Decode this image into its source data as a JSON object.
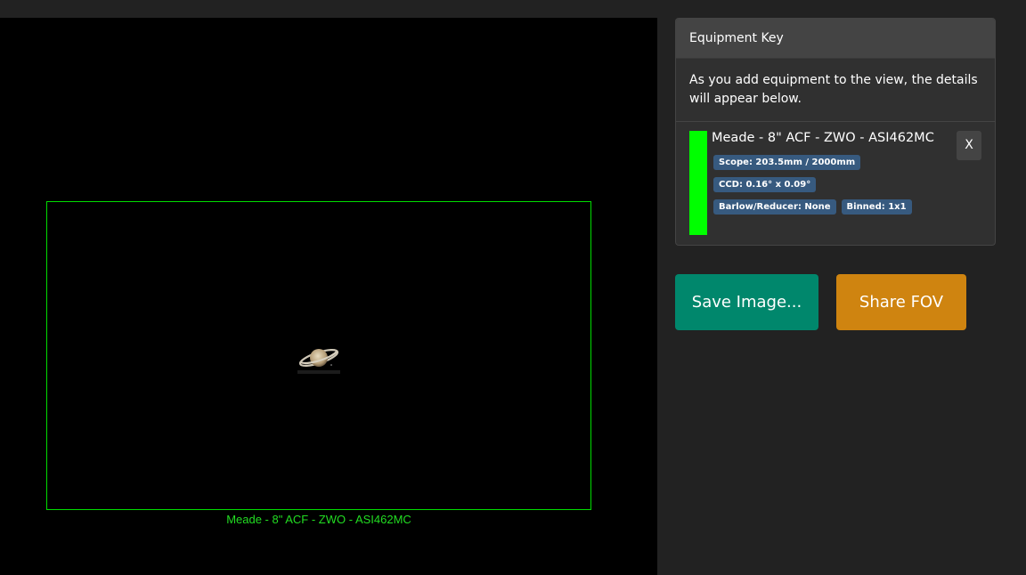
{
  "viewer": {
    "fov_label": "Meade - 8\" ACF - ZWO - ASI462MC",
    "fov_color": "#00dd00",
    "object_icon": "saturn-icon"
  },
  "equipment_key": {
    "title": "Equipment Key",
    "description": "As you add equipment to the view, the details will appear below.",
    "items": [
      {
        "name": "Meade - 8\" ACF - ZWO - ASI462MC",
        "color": "#00ff00",
        "badges": {
          "scope": "Scope: 203.5mm / 2000mm",
          "ccd": "CCD: 0.16° x 0.09°",
          "barlow": "Barlow/Reducer: None",
          "binned": "Binned: 1x1"
        },
        "remove_label": "X"
      }
    ]
  },
  "actions": {
    "save_label": "Save Image...",
    "share_label": "Share FOV",
    "save_color": "#00876c",
    "share_color": "#cf8410"
  }
}
